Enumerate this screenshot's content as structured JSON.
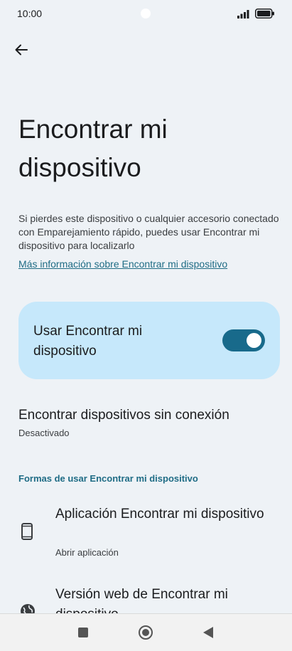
{
  "status_bar": {
    "time": "10:00"
  },
  "header": {
    "back_icon": "arrow-left-icon"
  },
  "page": {
    "title": "Encontrar mi dispositivo",
    "description": "Si pierdes este dispositivo o cualquier accesorio conectado con Emparejamiento rápido, puedes usar Encontrar mi dispositivo para localizarlo",
    "learn_more": "Más información sobre Encontrar mi dispositivo"
  },
  "main_toggle": {
    "label": "Usar Encontrar mi dispositivo",
    "enabled": true,
    "accent": "#186a8b",
    "card_color": "#c6e8fb"
  },
  "offline": {
    "title": "Encontrar dispositivos sin conexión",
    "status": "Desactivado"
  },
  "ways_section": {
    "header": "Formas de usar Encontrar mi dispositivo",
    "items": [
      {
        "title": "Aplicación Encontrar mi dispositivo",
        "subtitle": "Abrir aplicación",
        "icon": "phone-icon"
      },
      {
        "title": "Versión web de Encontrar mi dispositivo",
        "icon": "globe-icon"
      }
    ]
  },
  "nav_bar": {
    "icons": [
      "recents-square-icon",
      "home-circle-icon",
      "back-triangle-icon"
    ]
  }
}
